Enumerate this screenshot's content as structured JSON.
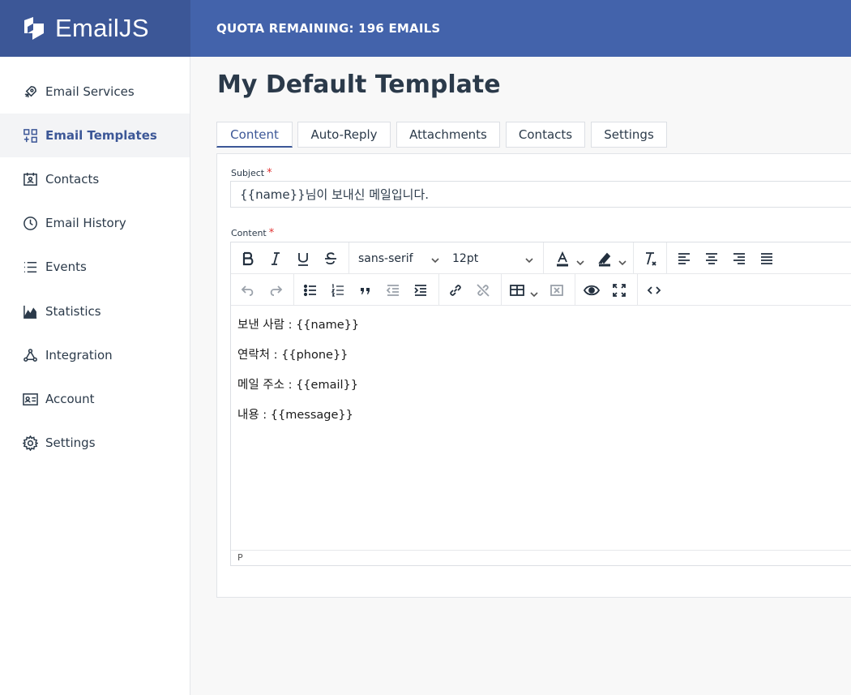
{
  "app": {
    "logo_text": "EmailJS"
  },
  "header": {
    "quota": "QUOTA REMAINING: 196 EMAILS"
  },
  "sidebar": {
    "items": [
      {
        "label": "Email Services",
        "icon": "rocket-icon"
      },
      {
        "label": "Email Templates",
        "icon": "templates-icon",
        "active": true
      },
      {
        "label": "Contacts",
        "icon": "contacts-icon"
      },
      {
        "label": "Email History",
        "icon": "history-icon"
      },
      {
        "label": "Events",
        "icon": "list-icon"
      },
      {
        "label": "Statistics",
        "icon": "chart-icon"
      },
      {
        "label": "Integration",
        "icon": "integration-icon"
      },
      {
        "label": "Account",
        "icon": "id-card-icon"
      },
      {
        "label": "Settings",
        "icon": "gear-icon"
      }
    ]
  },
  "main": {
    "title": "My Default Template",
    "tabs": [
      {
        "label": "Content",
        "active": true
      },
      {
        "label": "Auto-Reply"
      },
      {
        "label": "Attachments"
      },
      {
        "label": "Contacts"
      },
      {
        "label": "Settings"
      }
    ],
    "subject_label": "Subject",
    "subject_value": "{{name}}님이 보내신 메일입니다.",
    "content_label": "Content",
    "required_mark": "*"
  },
  "editor": {
    "font_family": "sans-serif",
    "font_size": "12pt",
    "status_path": "P",
    "lines": [
      "보낸 사람 : {{name}}",
      "연락처 : {{phone}}",
      "메일 주소 : {{email}}",
      "내용 : {{message}}"
    ]
  },
  "colors": {
    "brand_dark": "#3c5797",
    "brand": "#4363ab",
    "required": "#e03131"
  }
}
